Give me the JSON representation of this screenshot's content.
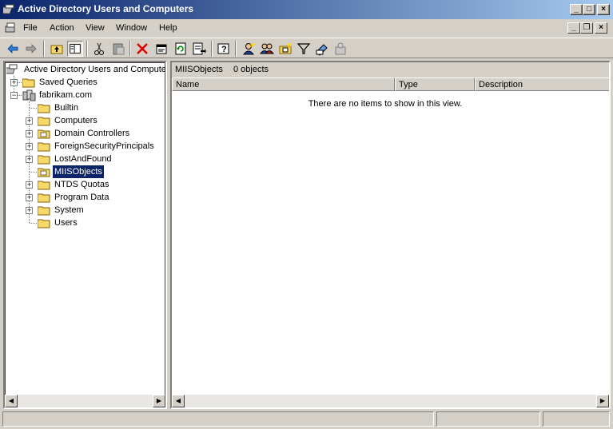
{
  "window": {
    "title": "Active Directory Users and Computers"
  },
  "menu": [
    {
      "label": "File"
    },
    {
      "label": "Action"
    },
    {
      "label": "View"
    },
    {
      "label": "Window"
    },
    {
      "label": "Help"
    }
  ],
  "toolbar": {
    "icons": [
      "back-icon",
      "forward-icon",
      "up-folder-icon",
      "show-hide-tree-icon",
      "cut-icon",
      "paste-icon",
      "delete-icon",
      "properties-icon",
      "refresh-icon",
      "export-list-icon",
      "help-icon",
      "new-user-icon",
      "new-group-icon",
      "new-ou-icon",
      "filter-icon",
      "find-icon",
      "add-to-group-icon"
    ]
  },
  "tree": {
    "root": "Active Directory Users and Computer",
    "saved_queries": "Saved Queries",
    "domain": "fabrikam.com",
    "children": [
      {
        "label": "Builtin",
        "expandable": false
      },
      {
        "label": "Computers",
        "expandable": true
      },
      {
        "label": "Domain Controllers",
        "expandable": true
      },
      {
        "label": "ForeignSecurityPrincipals",
        "expandable": true
      },
      {
        "label": "LostAndFound",
        "expandable": true
      },
      {
        "label": "MIISObjects",
        "expandable": false,
        "selected": true
      },
      {
        "label": "NTDS Quotas",
        "expandable": true
      },
      {
        "label": "Program Data",
        "expandable": true
      },
      {
        "label": "System",
        "expandable": true
      },
      {
        "label": "Users",
        "expandable": false
      }
    ]
  },
  "details": {
    "container": "MIISObjects",
    "count": "0 objects",
    "columns": [
      "Name",
      "Type",
      "Description"
    ],
    "empty_message": "There are no items to show in this view."
  },
  "colors": {
    "title_start": "#0a246a",
    "title_end": "#a6caf0",
    "face": "#d4d0c8",
    "selection": "#0a246a",
    "folder": "#f8d868"
  }
}
